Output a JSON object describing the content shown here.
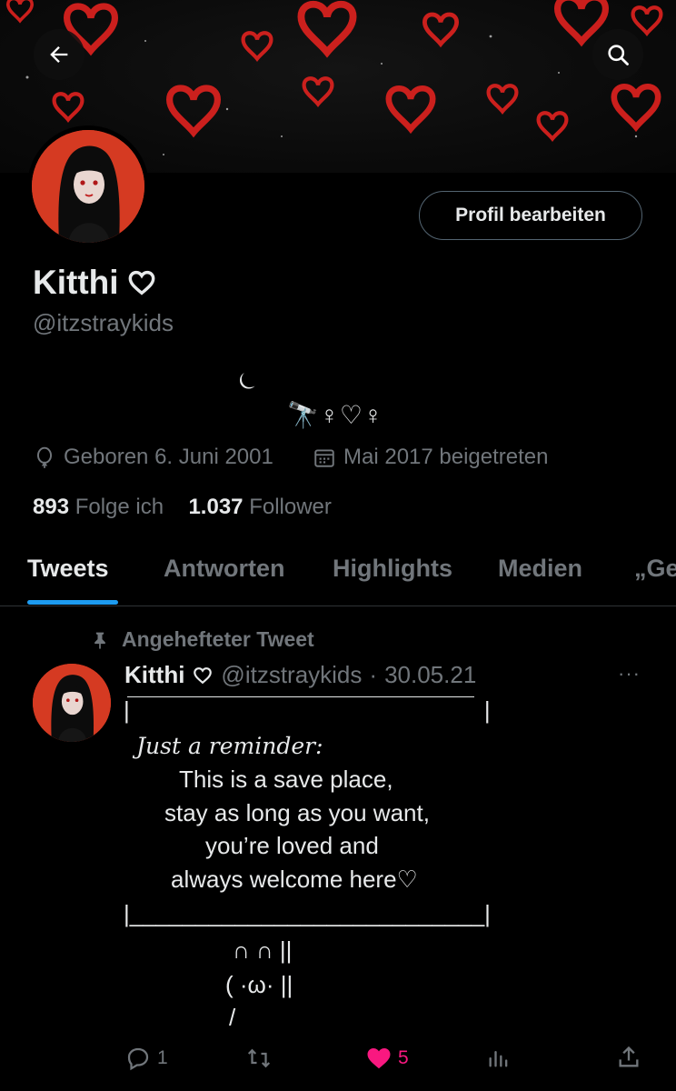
{
  "header": {
    "back_icon": "arrow-left-icon",
    "search_icon": "search-icon"
  },
  "banner": {
    "description_colors": {
      "background": "#0b0b0b",
      "heart": "#e0221f"
    }
  },
  "profile": {
    "edit_button": "Profil bearbeiten",
    "name": "Kitthi",
    "handle": "@itzstraykids",
    "bio_line1": "⏾",
    "bio_line2": "🔭♀♡♀",
    "born": "Geboren 6. Juni 2001",
    "joined": "Mai 2017 beigetreten",
    "following_count": "893",
    "following_label": "Folge ich",
    "followers_count": "1.037",
    "followers_label": "Follower"
  },
  "tabs": [
    {
      "label": "Tweets",
      "active": true
    },
    {
      "label": "Antworten",
      "active": false
    },
    {
      "label": "Highlights",
      "active": false
    },
    {
      "label": "Medien",
      "active": false
    },
    {
      "label": "„Ge",
      "active": false
    }
  ],
  "tweet": {
    "pinned_label": "Angehefteter Tweet",
    "author_name": "Kitthi",
    "author_handle": "@itzstraykids",
    "separator": "·",
    "date": "30.05.21",
    "more_icon": "···",
    "lines": {
      "top_border": "|                                                      |",
      "reminder": "Just a reminder:",
      "l1": "This is a save place,",
      "l2": "stay as long as you want,",
      "l3": "you’re loved and",
      "l4": "always welcome here♡",
      "bottom_border": "|___________________________|",
      "bunny1": "∩ ∩ ||",
      "bunny2": "( ·ω· ||",
      "bunny3": "/"
    },
    "reply_count": "1",
    "like_count": "5",
    "accent": "#1d9bf0",
    "like_color": "#f91880"
  }
}
